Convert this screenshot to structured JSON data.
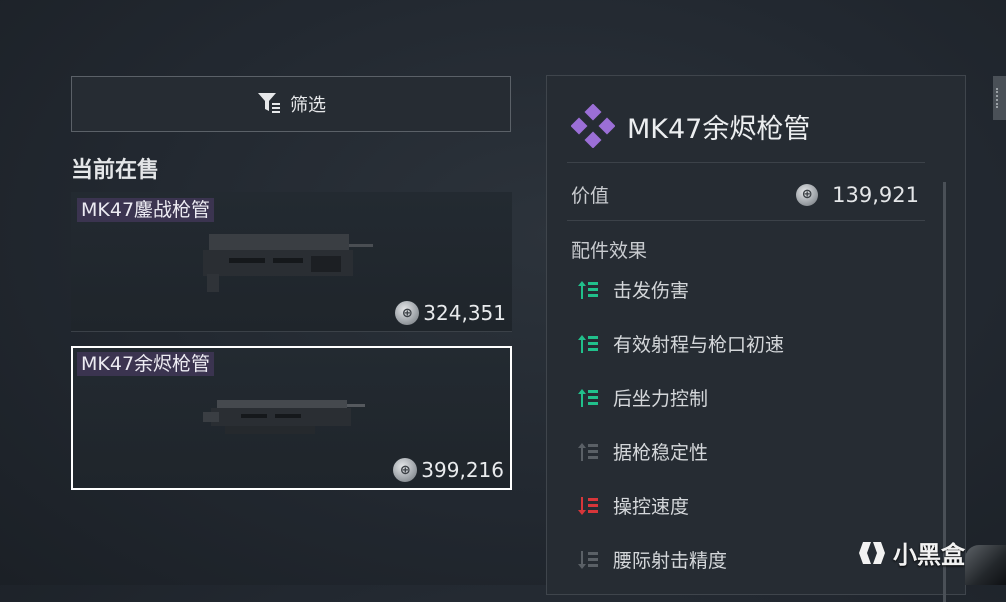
{
  "filter": {
    "label": "筛选",
    "icon": "filter-icon"
  },
  "market": {
    "section_title": "当前在售",
    "listings": [
      {
        "name": "MK47鏖战枪管",
        "price": "324,351",
        "selected": false
      },
      {
        "name": "MK47余烬枪管",
        "price": "399,216",
        "selected": true
      }
    ]
  },
  "detail": {
    "title": "MK47余烬枪管",
    "rarity_color": "#9b6fd6",
    "value_label": "价值",
    "value": "139,921",
    "effects_title": "配件效果",
    "effects": [
      {
        "label": "击发伤害",
        "trend": "up",
        "color": "#21c08b"
      },
      {
        "label": "有效射程与枪口初速",
        "trend": "up",
        "color": "#21c08b"
      },
      {
        "label": "后坐力控制",
        "trend": "up",
        "color": "#21c08b"
      },
      {
        "label": "据枪稳定性",
        "trend": "neutral",
        "color": "#5a6066"
      },
      {
        "label": "操控速度",
        "trend": "down",
        "color": "#d8363a"
      },
      {
        "label": "腰际射击精度",
        "trend": "neutral",
        "color": "#5a6066"
      }
    ]
  },
  "watermark": {
    "text": "小黑盒"
  }
}
